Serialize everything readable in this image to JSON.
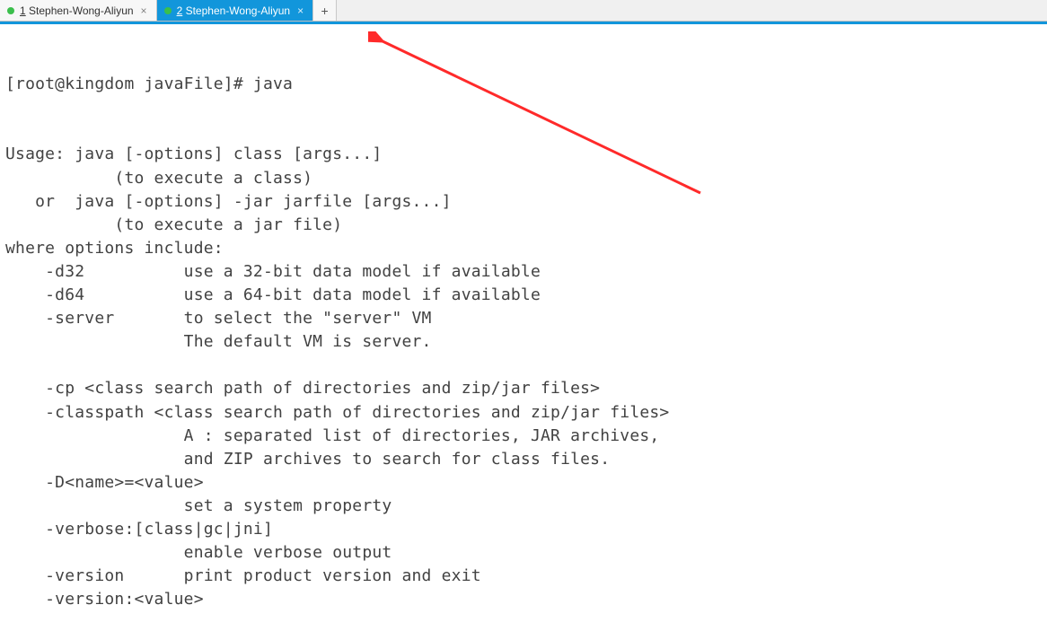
{
  "tabs": {
    "items": [
      {
        "prefix": "1",
        "label": " Stephen-Wong-Aliyun",
        "dotColor": "#3bbf4c",
        "active": false
      },
      {
        "prefix": "2",
        "label": " Stephen-Wong-Aliyun",
        "dotColor": "#3bbf4c",
        "active": true
      }
    ],
    "newTabGlyph": "+"
  },
  "prompt": "[root@kingdom javaFile]# java",
  "output_lines": [
    "Usage: java [-options] class [args...]",
    "           (to execute a class)",
    "   or  java [-options] -jar jarfile [args...]",
    "           (to execute a jar file)",
    "where options include:",
    "    -d32          use a 32-bit data model if available",
    "    -d64          use a 64-bit data model if available",
    "    -server       to select the \"server\" VM",
    "                  The default VM is server.",
    "",
    "    -cp <class search path of directories and zip/jar files>",
    "    -classpath <class search path of directories and zip/jar files>",
    "                  A : separated list of directories, JAR archives,",
    "                  and ZIP archives to search for class files.",
    "    -D<name>=<value>",
    "                  set a system property",
    "    -verbose:[class|gc|jni]",
    "                  enable verbose output",
    "    -version      print product version and exit",
    "    -version:<value>"
  ],
  "annotation": {
    "color": "#ff2a2a"
  }
}
